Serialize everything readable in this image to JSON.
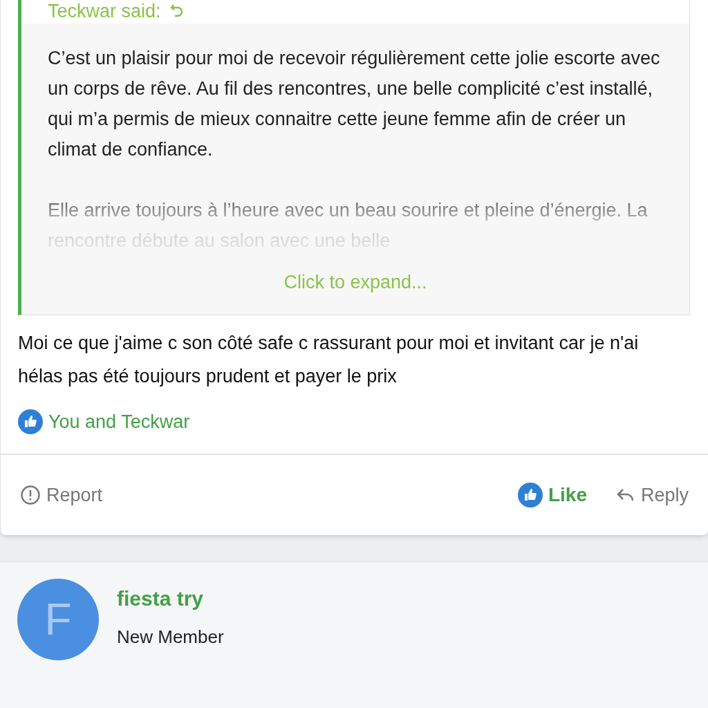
{
  "quote": {
    "author": "Teckwar said:",
    "paragraphs": [
      "C’est un plaisir pour moi de recevoir régulièrement cette jolie escorte avec un corps de rêve. Au fil des rencontres, une belle complicité c’est installé, qui m’a permis de mieux connaitre cette jeune femme afin de créer un climat de confiance.",
      "Elle arrive toujours à l’heure avec un beau sourire et pleine d’énergie. La rencontre débute au salon avec une belle"
    ],
    "expand": "Click to expand..."
  },
  "post_text": "Moi ce que j'aime c son côté safe c rassurant pour moi et invitant car je n'ai hélas pas été toujours prudent et payer le prix",
  "likes": "You and Teckwar",
  "actions": {
    "report": "Report",
    "like": "Like",
    "liked": true,
    "reply": "Reply"
  },
  "next_post": {
    "avatar_letter": "F",
    "name": "fiesta try",
    "role": "New Member"
  }
}
